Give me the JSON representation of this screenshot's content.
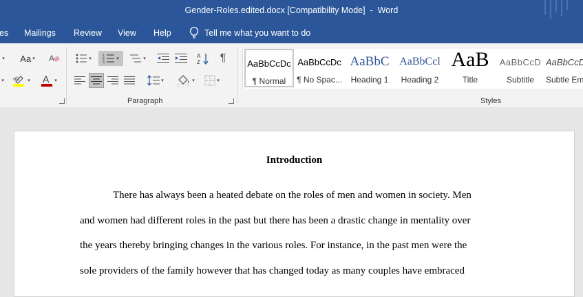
{
  "window": {
    "title": "Gender-Roles.edited.docx [Compatibility Mode]  -  Word"
  },
  "menu": {
    "items": [
      "es",
      "Mailings",
      "Review",
      "View",
      "Help"
    ],
    "tell_me": "Tell me what you want to do"
  },
  "ribbon": {
    "font": {
      "size_label": "Aa"
    },
    "paragraph": {
      "label": "Paragraph"
    },
    "styles": {
      "label": "Styles",
      "items": [
        {
          "sample": "AaBbCcDc",
          "name": "¶ Normal"
        },
        {
          "sample": "AaBbCcDc",
          "name": "¶ No Spac..."
        },
        {
          "sample": "AaBbC",
          "name": "Heading 1"
        },
        {
          "sample": "AaBbCcl",
          "name": "Heading 2"
        },
        {
          "sample": "AaB",
          "name": "Title"
        },
        {
          "sample": "AaBbCcD",
          "name": "Subtitle"
        },
        {
          "sample": "AaBbCcD",
          "name": "Subtle Em..."
        }
      ]
    },
    "colors": {
      "highlight": "#ffff00",
      "font_color": "#c00000"
    }
  },
  "document": {
    "heading": "Introduction",
    "lines": [
      "There has always been a heated debate on the roles of men and women in society. Men",
      "and women had different roles in the past but there has been a drastic change in mentality over",
      "the years thereby bringing changes in the various roles. For instance, in the past men were the",
      "sole providers of the family however that has changed today as many couples have embraced"
    ]
  }
}
